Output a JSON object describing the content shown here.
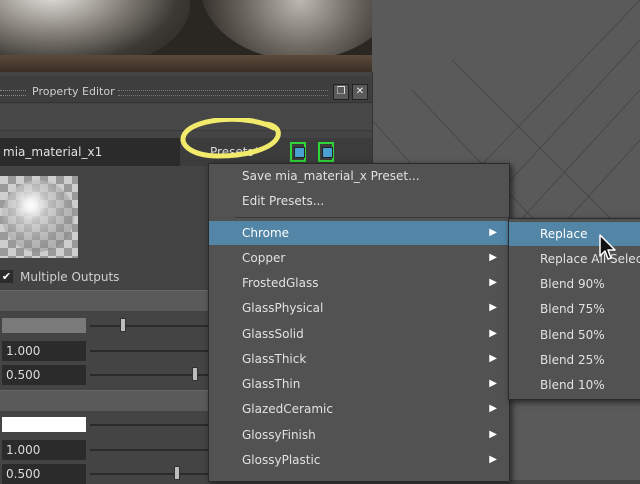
{
  "panel": {
    "title": "Property Editor",
    "float_glyph": "❐",
    "close_glyph": "✕",
    "material_name": "mia_material_x1",
    "presets_label": "Presets*",
    "multiple_outputs_label": "Multiple Outputs",
    "checkbox_glyph": "✔",
    "fields": {
      "value_1": "1.000",
      "value_2": "0.500",
      "value_3": "1.000",
      "value_4": "0.500"
    },
    "slot_colors": {
      "slot_1": "#7a7a7a",
      "slot_2": "#ffffff"
    }
  },
  "presets_menu": {
    "top_items": [
      {
        "label": "Save mia_material_x Preset..."
      },
      {
        "label": "Edit Presets..."
      }
    ],
    "items": [
      {
        "label": "Chrome",
        "selected": true
      },
      {
        "label": "Copper"
      },
      {
        "label": "FrostedGlass"
      },
      {
        "label": "GlassPhysical"
      },
      {
        "label": "GlassSolid"
      },
      {
        "label": "GlassThick"
      },
      {
        "label": "GlassThin"
      },
      {
        "label": "GlazedCeramic"
      },
      {
        "label": "GlossyFinish"
      },
      {
        "label": "GlossyPlastic"
      }
    ],
    "submenu_arrow": "▶"
  },
  "submenu": {
    "items": [
      {
        "label": "Replace",
        "selected": true
      },
      {
        "label": "Replace All Selected"
      },
      {
        "label": "Blend 90%"
      },
      {
        "label": "Blend 75%"
      },
      {
        "label": "Blend 50%"
      },
      {
        "label": "Blend 25%"
      },
      {
        "label": "Blend 10%"
      }
    ]
  },
  "colors": {
    "accent_selection": "#5285a6",
    "annotation_highlight": "#f2ea6a",
    "toolbar_icon_border": "#2fd63a"
  },
  "icons": [
    "float-window-icon",
    "close-icon",
    "material-swatch-icon",
    "checkbox-icon",
    "submenu-arrow-icon",
    "mouse-cursor-icon"
  ]
}
